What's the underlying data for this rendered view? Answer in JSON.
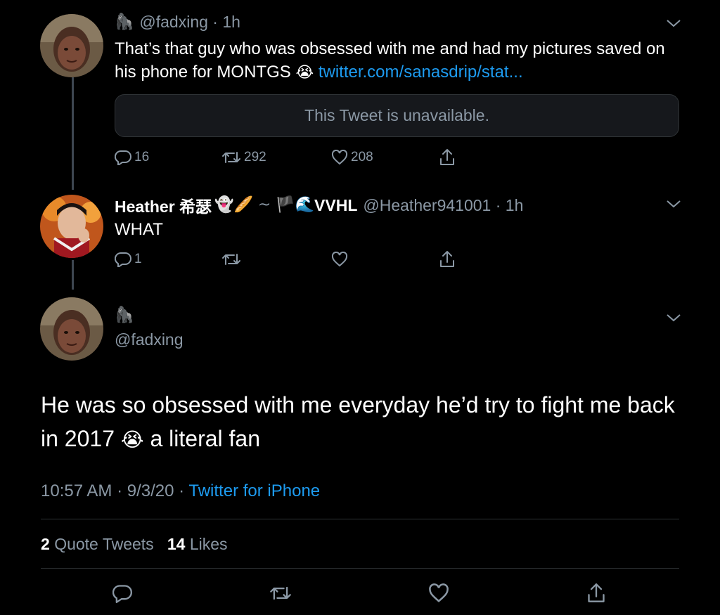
{
  "tweet1": {
    "handle_prefix": "🦍",
    "handle": "@fadxing",
    "time": "1h",
    "text": "That’s that guy who was obsessed with me and had my pictures saved on his phone for MONTGS",
    "emoji": "😭",
    "link": "twitter.com/sanasdrip/stat...",
    "quote_unavailable": "This Tweet is unavailable.",
    "replies": "16",
    "retweets": "292",
    "likes": "208"
  },
  "tweet2": {
    "name": "Heather 希瑟",
    "name_emojis": "👻🥖 ~ 🏴🌊",
    "name_suffix": "VVHL",
    "handle": "@Heather941001",
    "time": "1h",
    "text": "WHAT",
    "replies": "1"
  },
  "main_tweet": {
    "display_emoji": "🦍",
    "handle": "@fadxing",
    "text_part1": "He was so obsessed with me everyday he’d try to fight me back in 2017",
    "emoji": "😭",
    "text_part2": "a literal fan",
    "time": "10:57 AM",
    "date": "9/3/20",
    "source": "Twitter for iPhone",
    "quote_count": "2",
    "quote_label": "Quote Tweets",
    "like_count": "14",
    "like_label": "Likes"
  },
  "colors": {
    "background": "#000000",
    "secondary_text": "#8b98a5",
    "link": "#1d9bf0",
    "divider": "#2f3336"
  },
  "icons": [
    "reply-icon",
    "retweet-icon",
    "like-icon",
    "share-icon",
    "chevron-down-icon"
  ]
}
